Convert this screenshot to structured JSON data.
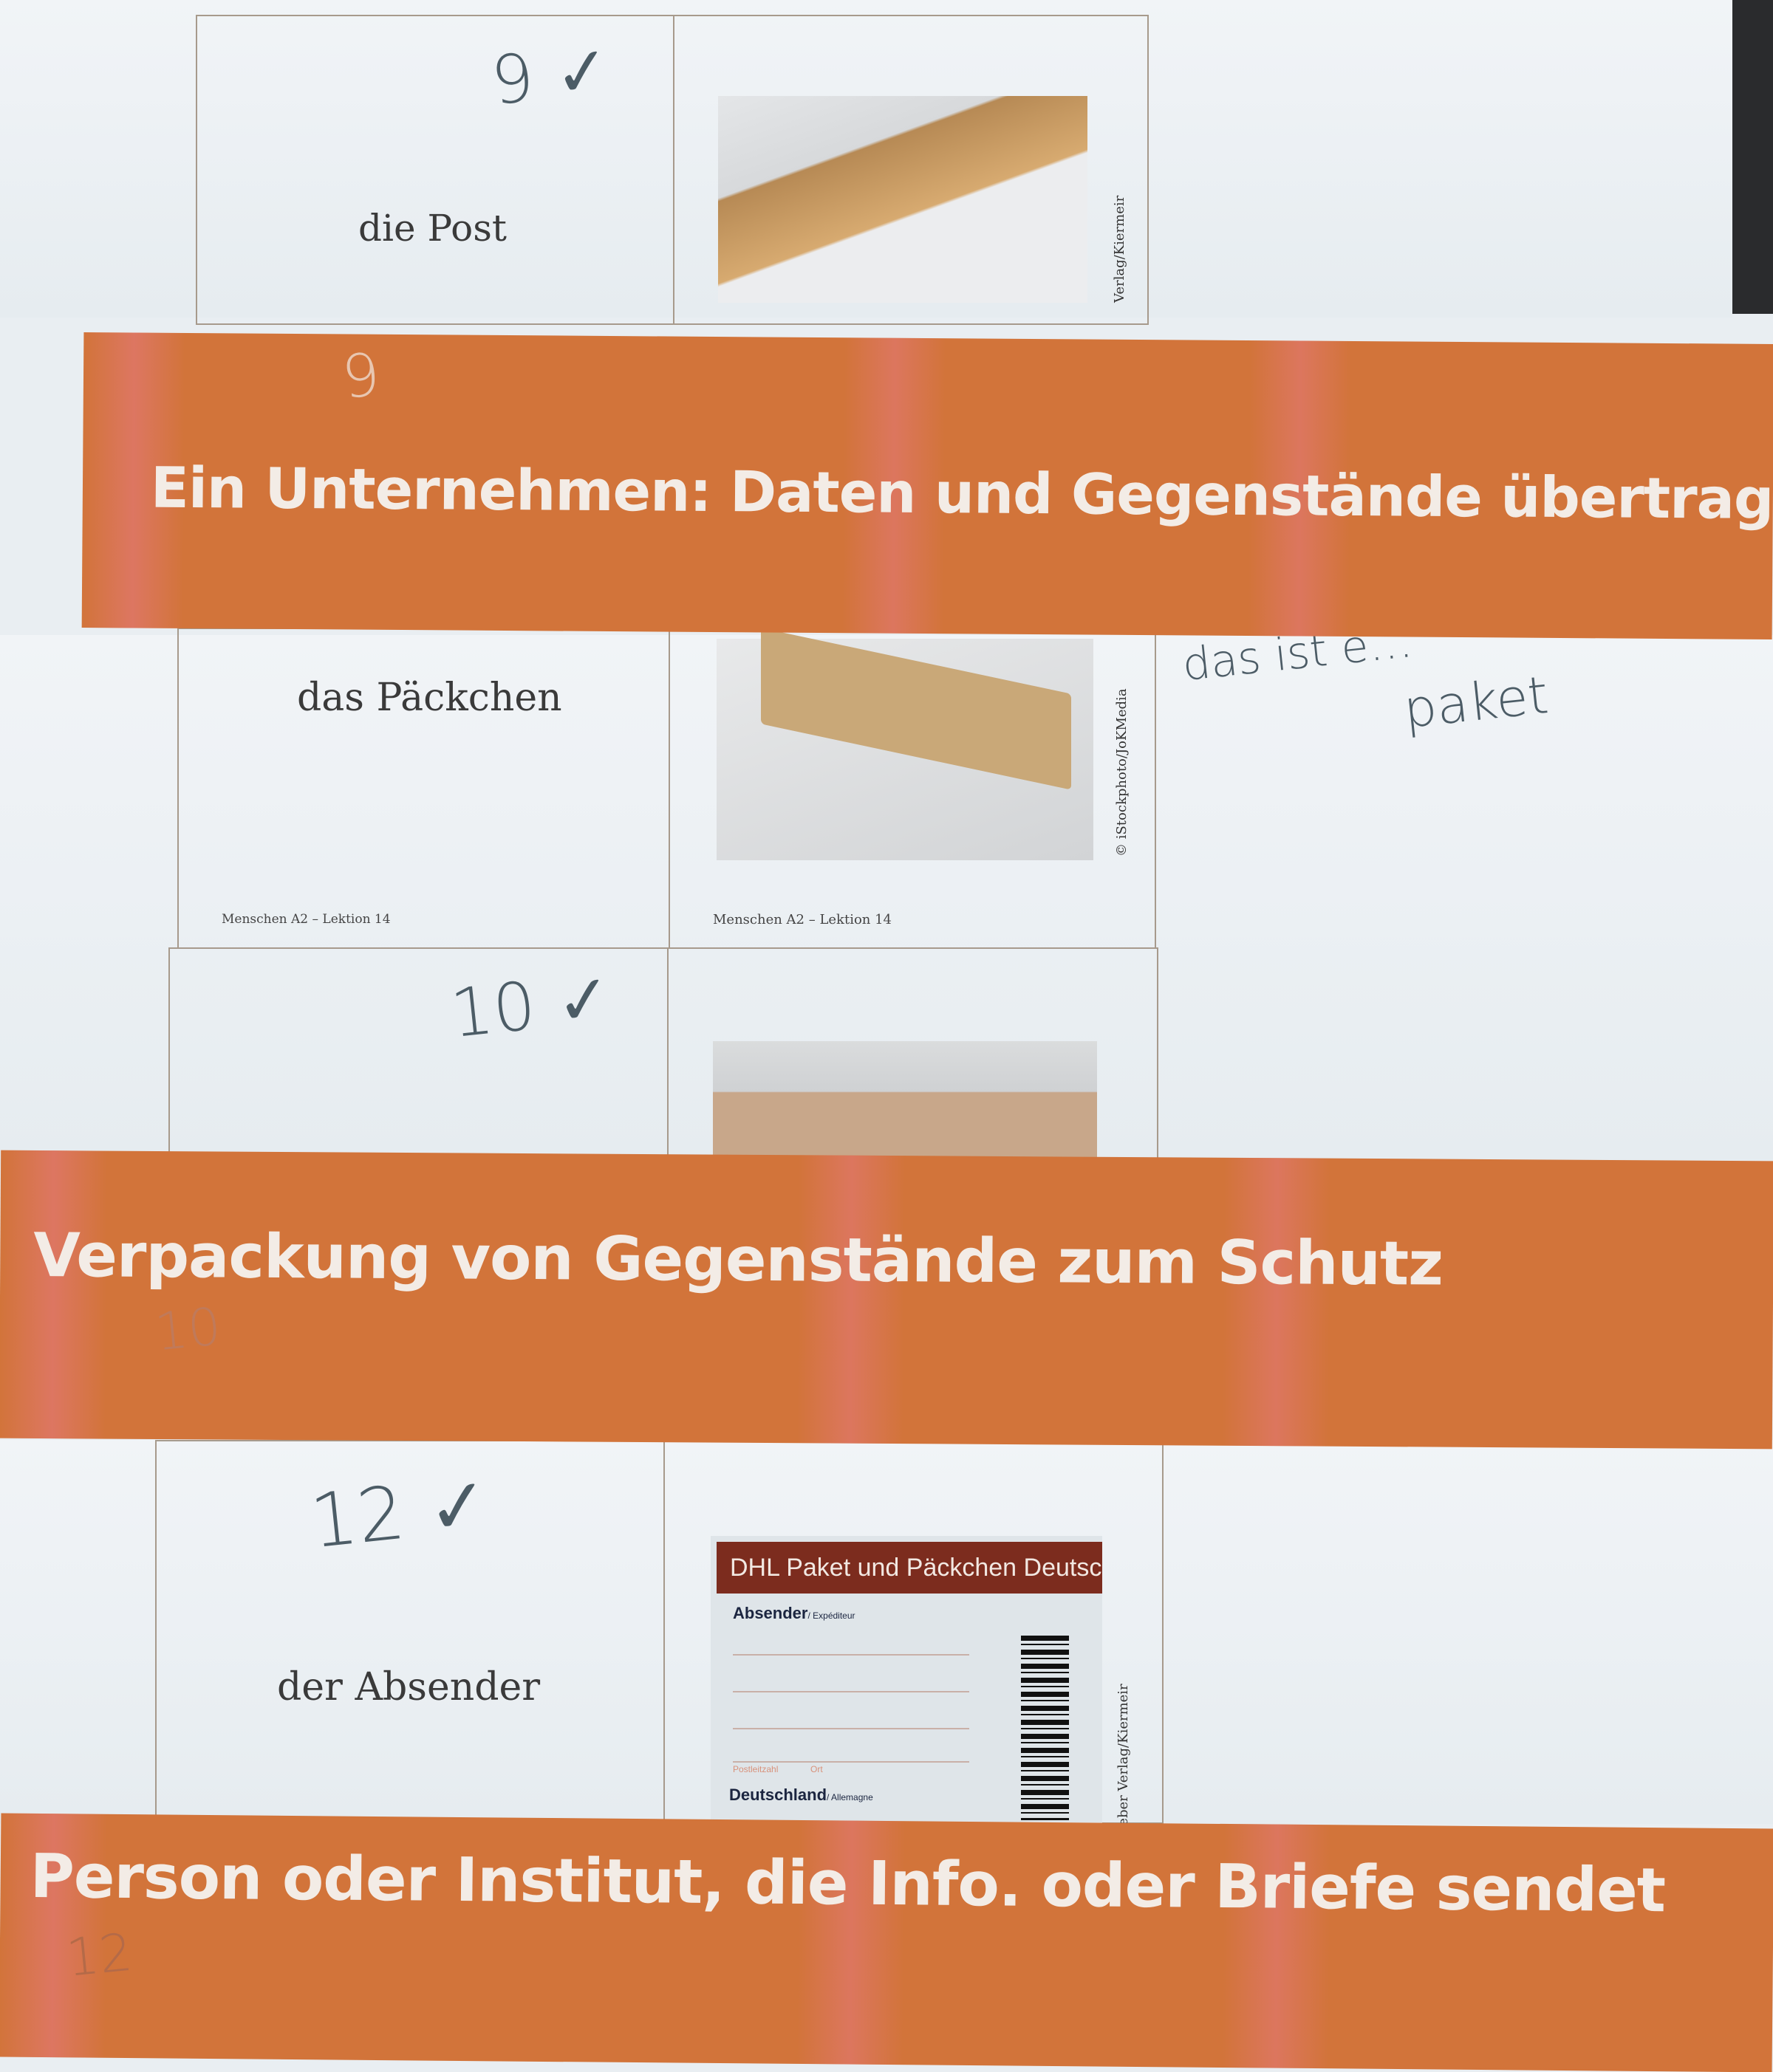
{
  "cards": {
    "post": {
      "word": "die Post",
      "mark": "9 ✓",
      "credit": "Verlag/Kiermeir"
    },
    "paeckchen": {
      "word": "das Päckchen",
      "credit": "© iStockphoto/JoKMedia",
      "footer_left": "Menschen A2 – Lektion 14",
      "footer_right": "Menschen A2 – Lektion 14"
    },
    "paket": {
      "mark": "10 ✓",
      "note_line1": "das ist e…",
      "note_line2": "paket"
    },
    "absender": {
      "word": "der Absender",
      "mark": "12 ✓",
      "credit": "Hueber Verlag/Kiermeir",
      "label": {
        "header": "DHL Paket und Päckchen Deutsch",
        "sender": "Absender",
        "sender_fr": "/ Expéditeur",
        "postcode": "Postleitzahl",
        "city": "Ort",
        "country": "Deutschland",
        "country_fr": "/ Allemagne"
      }
    }
  },
  "strips": [
    {
      "text": "Ein Unternehmen: Daten und Gegenstände übertragen",
      "mark": "9"
    },
    {
      "text": "Verpackung von Gegenstände zum Schutz",
      "mark": "10"
    },
    {
      "text": "Person oder Institut, die Info. oder Briefe sendet",
      "mark": "12"
    }
  ]
}
